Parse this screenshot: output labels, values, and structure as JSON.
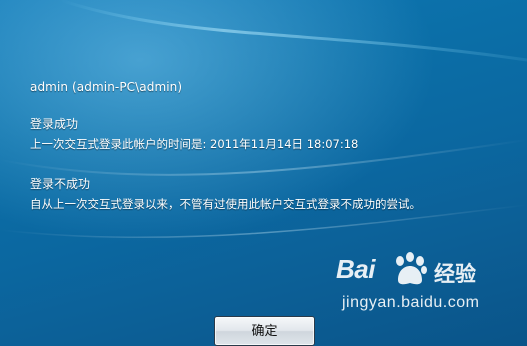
{
  "login_info": {
    "user_line": "admin (admin-PC\\admin)",
    "success": {
      "title": "登录成功",
      "detail": "上一次交互式登录此帐户的时间是: 2011年11月14日 18:07:18"
    },
    "failure": {
      "title": "登录不成功",
      "detail": "自从上一次交互式登录以来，不管有过使用此帐户交互式登录不成功的尝试。"
    }
  },
  "buttons": {
    "ok_label": "确定"
  },
  "watermark": {
    "brand_bai": "Bai",
    "brand_jingyan": "经验",
    "url": "jingyan.baidu.com"
  },
  "colors": {
    "background": "#0b6fa8",
    "text": "#ffffff"
  }
}
